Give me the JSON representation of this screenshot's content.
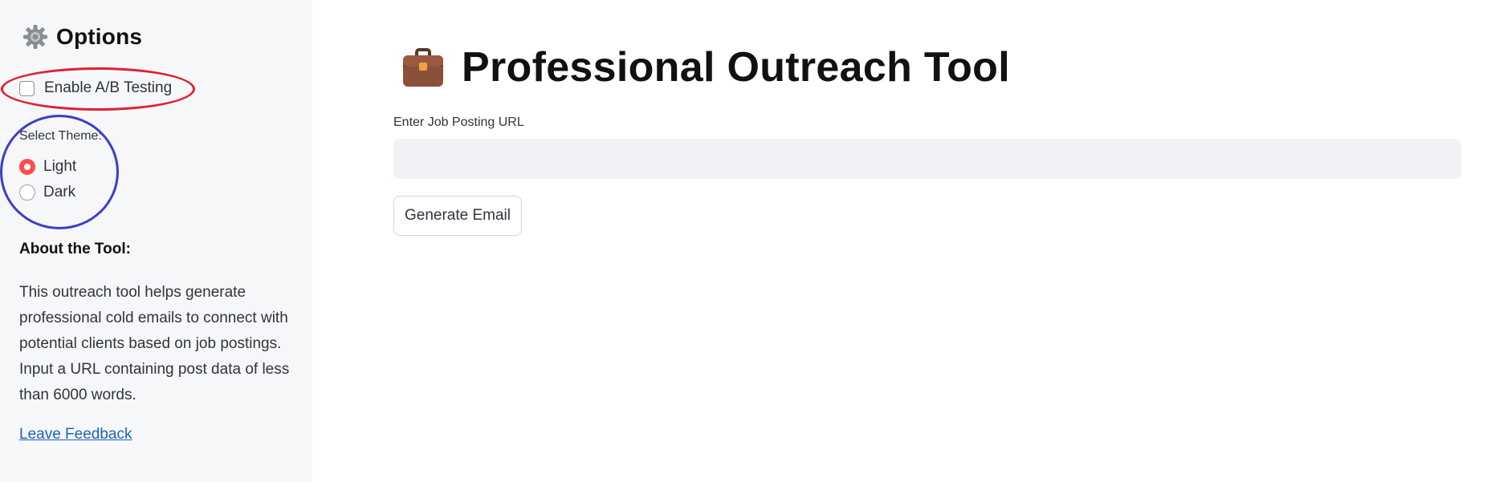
{
  "sidebar": {
    "title": "Options",
    "title_icon": "gear-icon",
    "ab_testing": {
      "label": "Enable A/B Testing",
      "checked": false
    },
    "theme": {
      "label": "Select Theme:",
      "options": [
        {
          "label": "Light",
          "selected": true
        },
        {
          "label": "Dark",
          "selected": false
        }
      ]
    },
    "about": {
      "title": "About the Tool:",
      "text": "This outreach tool helps generate professional cold emails to connect with potential clients based on job postings. Input a URL containing post data of less than 6000 words."
    },
    "feedback_link": "Leave Feedback"
  },
  "main": {
    "title": "Professional Outreach Tool",
    "title_icon": "briefcase-icon",
    "url_input": {
      "label": "Enter Job Posting URL",
      "value": "",
      "placeholder": ""
    },
    "generate_button": "Generate Email"
  },
  "annotations": {
    "red_highlight": "ellipse around Enable A/B Testing",
    "blue_highlight": "circle around theme selector"
  },
  "colors": {
    "accent": "#ff4b4b",
    "sidebar_bg": "#f6f7f9",
    "input_bg": "#f0f2f6",
    "link": "#1c62b9",
    "red_annotation": "#e0212e",
    "blue_annotation": "#3b3fca"
  }
}
